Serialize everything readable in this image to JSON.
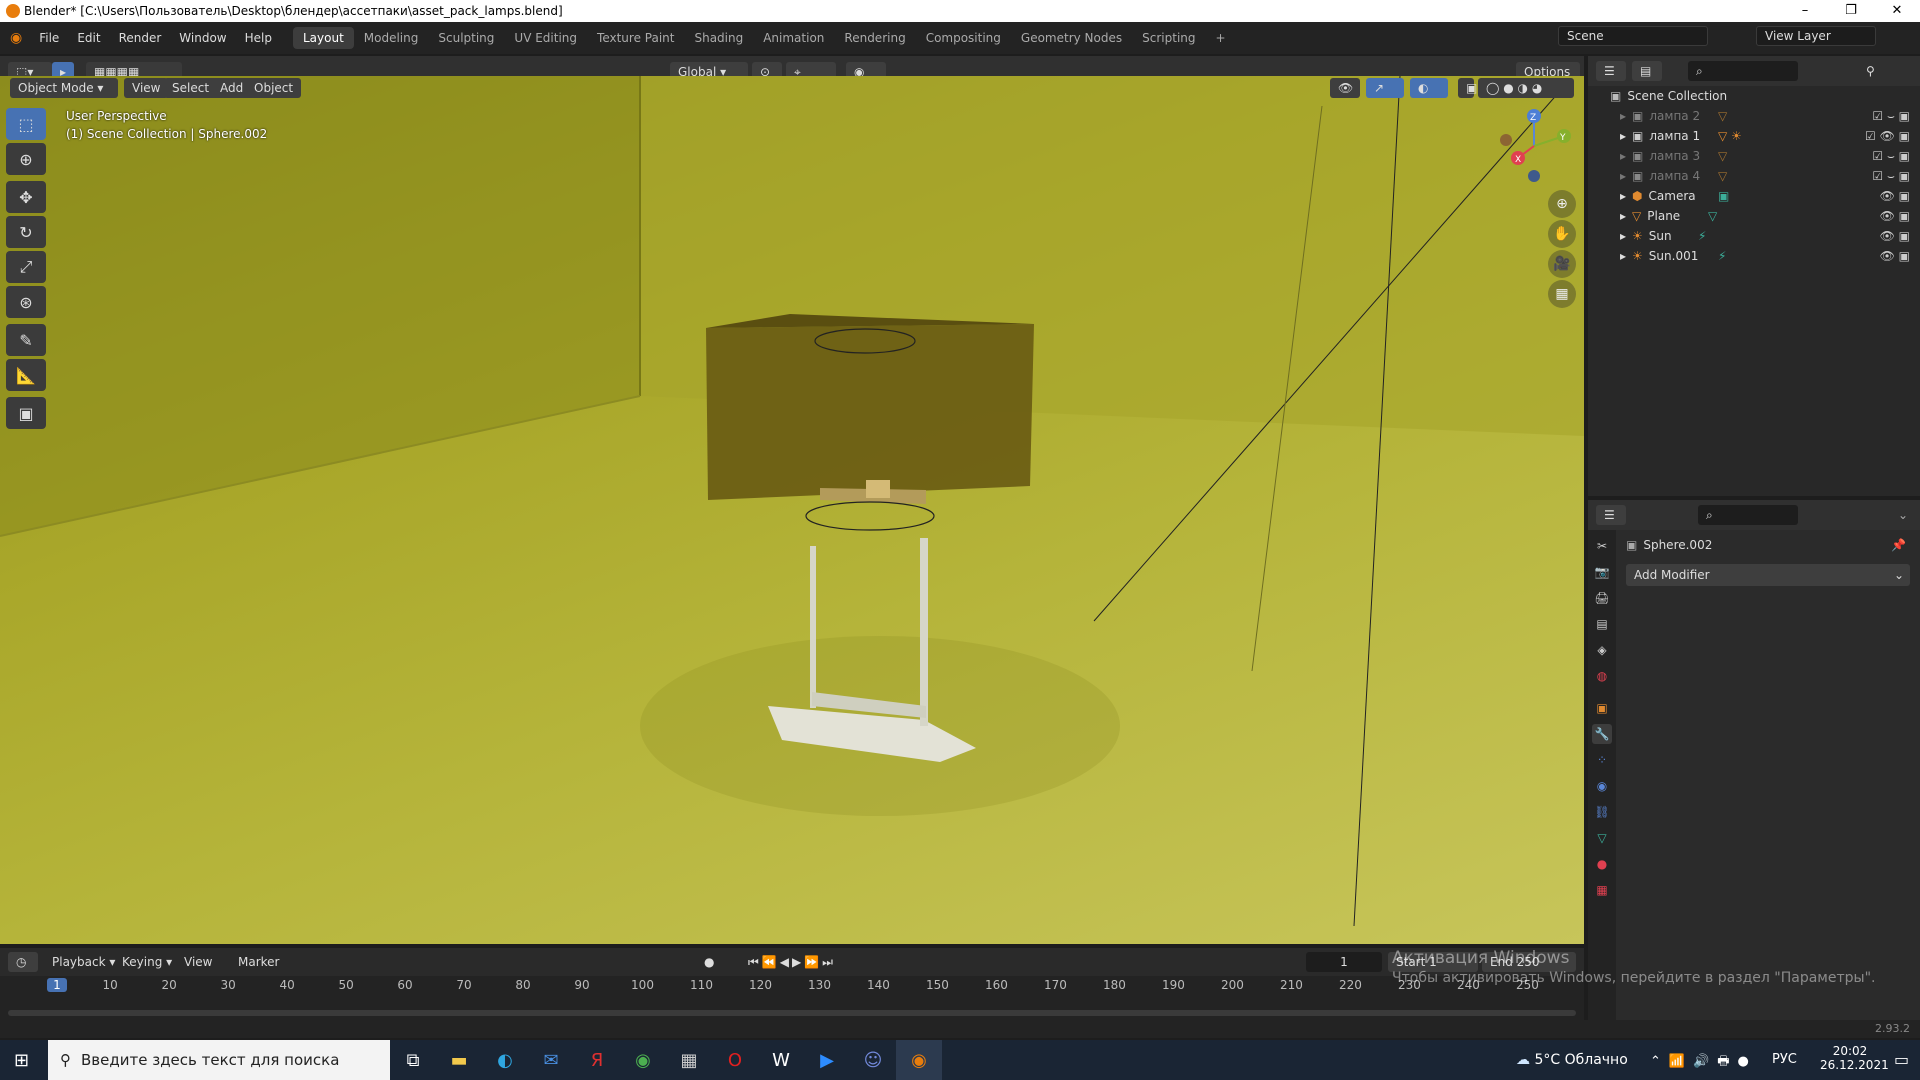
{
  "window": {
    "title": "Blender* [C:\\Users\\Пользователь\\Desktop\\блендер\\ассетпаки\\asset_pack_lamps.blend]"
  },
  "menu": [
    "File",
    "Edit",
    "Render",
    "Window",
    "Help"
  ],
  "workspaces": [
    "Layout",
    "Modeling",
    "Sculpting",
    "UV Editing",
    "Texture Paint",
    "Shading",
    "Animation",
    "Rendering",
    "Compositing",
    "Geometry Nodes",
    "Scripting",
    "+"
  ],
  "scene": "Scene",
  "view_layer": "View Layer",
  "header": {
    "mode": "Object Mode",
    "view": "View",
    "select": "Select",
    "add": "Add",
    "object": "Object",
    "orientation": "Global",
    "options": "Options"
  },
  "viewport": {
    "perspective": "User Perspective",
    "collection_info": "(1) Scene Collection | Sphere.002",
    "gizmo": {
      "x": "X",
      "y": "Y",
      "z": "Z"
    }
  },
  "outliner": {
    "root": "Scene Collection",
    "items": [
      {
        "name": "лампа 2",
        "dim": true
      },
      {
        "name": "лампа 1",
        "dim": false
      },
      {
        "name": "лампа 3",
        "dim": true
      },
      {
        "name": "лампа 4",
        "dim": true
      },
      {
        "name": "Camera",
        "dim": false
      },
      {
        "name": "Plane",
        "dim": false
      },
      {
        "name": "Sun",
        "dim": false
      },
      {
        "name": "Sun.001",
        "dim": false
      }
    ]
  },
  "properties": {
    "object_name": "Sphere.002",
    "add_modifier": "Add Modifier"
  },
  "timeline": {
    "playback": "Playback",
    "keying": "Keying",
    "view": "View",
    "marker": "Marker",
    "current_frame": "1",
    "start_label": "Start",
    "start_value": "1",
    "end_label": "End",
    "end_value": "250",
    "ticks": [
      "1",
      "10",
      "20",
      "30",
      "40",
      "50",
      "60",
      "70",
      "80",
      "90",
      "100",
      "110",
      "120",
      "130",
      "140",
      "150",
      "160",
      "170",
      "180",
      "190",
      "200",
      "210",
      "220",
      "230",
      "240",
      "250"
    ]
  },
  "status": {
    "version": "2.93.2"
  },
  "watermark": {
    "line1": "Активация Windows",
    "line2": "Чтобы активировать Windows, перейдите в раздел \"Параметры\"."
  },
  "taskbar": {
    "search_placeholder": "Введите здесь текст для поиска",
    "weather": "5°C Облачно",
    "language": "РУС",
    "time": "20:02",
    "date": "26.12.2021"
  },
  "colors": {
    "accent": "#4772b3",
    "viewport_bg": "#b5b43a",
    "blender_orange": "#e87d0d"
  }
}
